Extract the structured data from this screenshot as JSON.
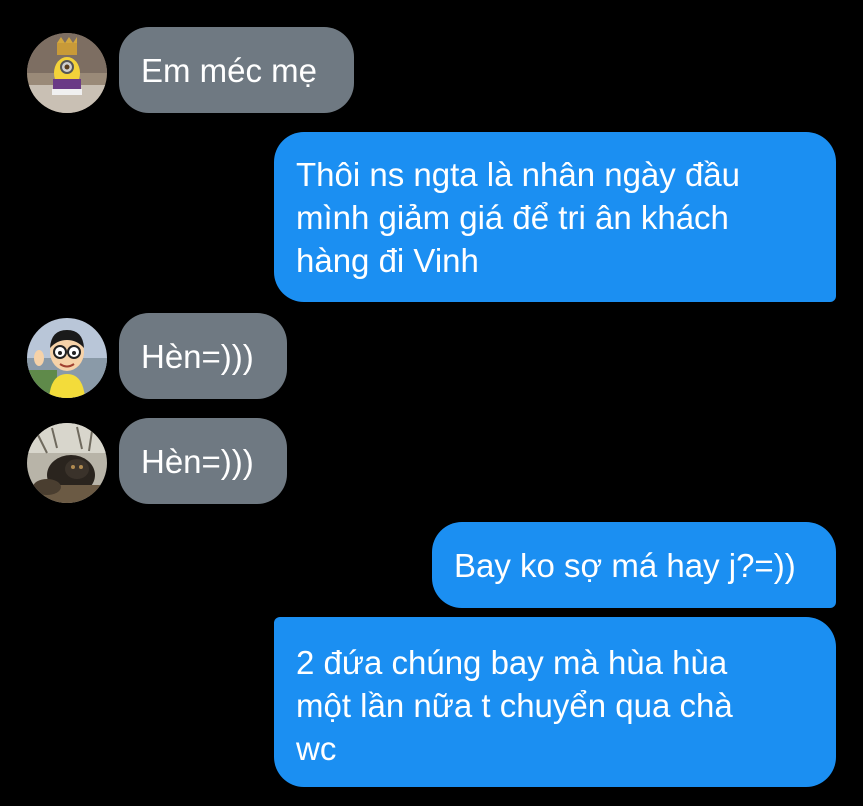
{
  "messages": [
    {
      "direction": "incoming",
      "avatar": "avatar-king-minion",
      "text": "Em méc mẹ"
    },
    {
      "direction": "outgoing",
      "text": "Thôi ns ngta là nhân ngày đầu\nmình giảm giá để tri ân khách\nhàng đi Vinh"
    },
    {
      "direction": "incoming",
      "avatar": "avatar-cartoon-boy-glasses",
      "text": "Hèn=)))"
    },
    {
      "direction": "incoming",
      "avatar": "avatar-ape-photo",
      "text": "Hèn=)))"
    },
    {
      "direction": "outgoing",
      "text": "Bay ko sợ má hay j?=))"
    },
    {
      "direction": "outgoing",
      "text": "2 đứa chúng bay mà hùa hùa\nmột lần nữa t chuyển qua chà\nwc"
    }
  ],
  "colors": {
    "background": "#000000",
    "incoming_bubble": "#6f7982",
    "outgoing_bubble": "#1b8ff2",
    "text": "#ffffff"
  }
}
